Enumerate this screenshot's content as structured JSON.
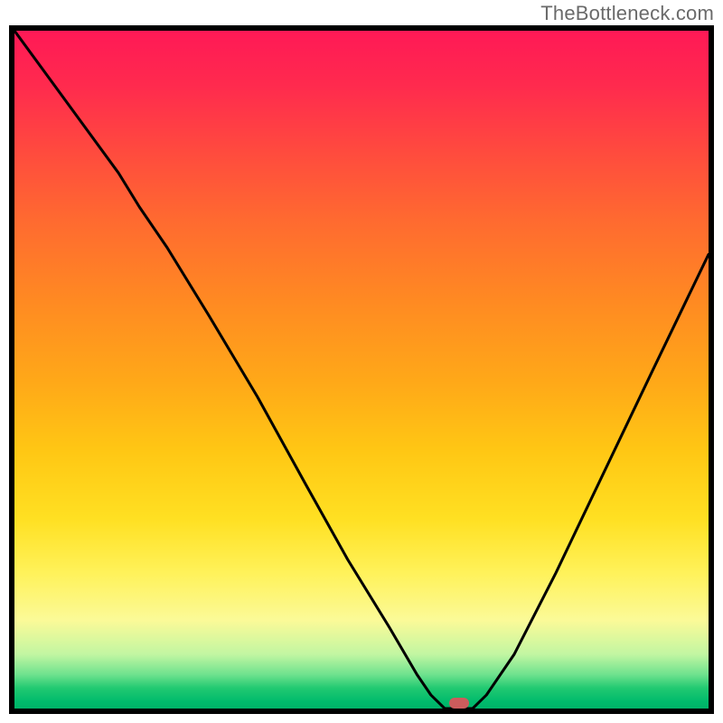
{
  "watermark": "TheBottleneck.com",
  "chart_data": {
    "type": "line",
    "title": "",
    "xlabel": "",
    "ylabel": "",
    "xlim": [
      0,
      100
    ],
    "ylim": [
      0,
      100
    ],
    "grid": false,
    "series": [
      {
        "name": "bottleneck-curve",
        "x": [
          0,
          5,
          10,
          15,
          18,
          22,
          28,
          35,
          42,
          48,
          54,
          58,
          60,
          62,
          64,
          66,
          68,
          72,
          78,
          85,
          92,
          100
        ],
        "values": [
          100,
          93,
          86,
          79,
          74,
          68,
          58,
          46,
          33,
          22,
          12,
          5,
          2,
          0,
          0,
          0,
          2,
          8,
          20,
          35,
          50,
          67
        ]
      }
    ],
    "annotations": [
      {
        "name": "minimum-marker",
        "x": 64,
        "y": 0.8
      }
    ],
    "background": {
      "type": "vertical-gradient",
      "stops": [
        {
          "pos": 0.0,
          "color": "#ff1956"
        },
        {
          "pos": 0.18,
          "color": "#ff4b3e"
        },
        {
          "pos": 0.4,
          "color": "#ff8a22"
        },
        {
          "pos": 0.62,
          "color": "#ffc714"
        },
        {
          "pos": 0.8,
          "color": "#fff25a"
        },
        {
          "pos": 0.92,
          "color": "#c2f6a2"
        },
        {
          "pos": 0.97,
          "color": "#21c971"
        },
        {
          "pos": 1.0,
          "color": "#00b268"
        }
      ]
    },
    "colors": {
      "curve": "#000000",
      "marker": "#cc5c5c",
      "frame": "#000000"
    }
  }
}
